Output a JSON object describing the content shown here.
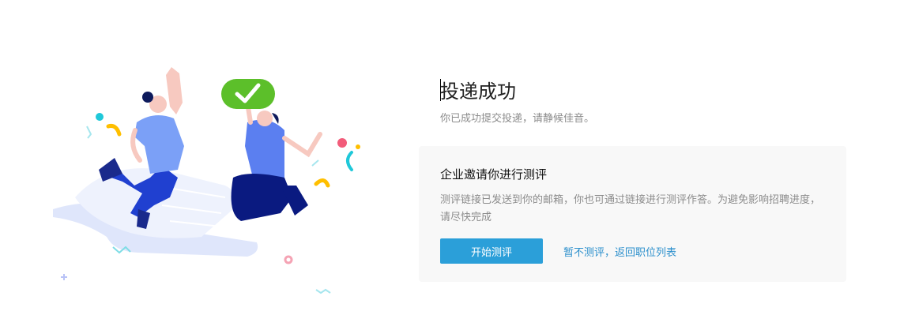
{
  "result": {
    "title": "投递成功",
    "subtitle": "你已成功提交投递，请静候佳音。"
  },
  "assessment": {
    "title": "企业邀请你进行测评",
    "description": "测评链接已发送到你的邮箱，你也可通过链接进行测评作答。为避免影响招聘进度，请尽快完成",
    "start_button": "开始测评",
    "skip_link": "暂不测评，返回职位列表"
  },
  "colors": {
    "primary": "#2b9fd9",
    "link": "#2b8fcc",
    "check_badge": "#5cbf2a",
    "figure_blue": "#6b8cf5",
    "figure_navy": "#1a2a8c",
    "paper": "#dfe6fb"
  },
  "icons": {
    "illustration": "celebration-illustration",
    "check": "check-badge-icon"
  }
}
